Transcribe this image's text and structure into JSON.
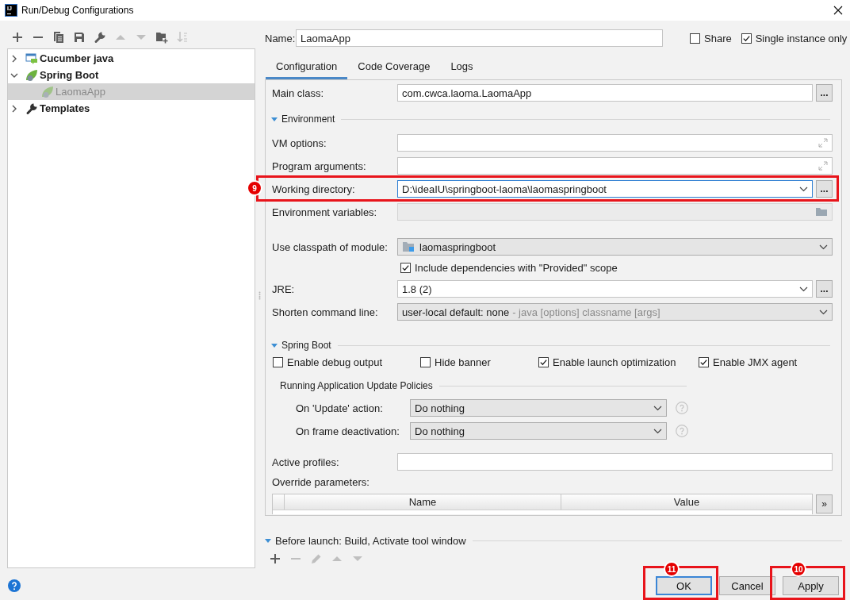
{
  "window": {
    "logo": "IJ",
    "title": "Run/Debug Configurations"
  },
  "sidebar": {
    "toolbar": [
      {
        "kind": "add",
        "disabled": false
      },
      {
        "kind": "remove",
        "disabled": false
      },
      {
        "kind": "copy",
        "disabled": false
      },
      {
        "kind": "save",
        "disabled": false
      },
      {
        "kind": "wrench",
        "disabled": false
      },
      {
        "kind": "up",
        "disabled": true
      },
      {
        "kind": "down",
        "disabled": true
      },
      {
        "kind": "folder",
        "disabled": false
      },
      {
        "kind": "sort",
        "disabled": true
      }
    ],
    "tree": [
      {
        "label": "Cucumber java",
        "kind": "cucumber",
        "expanded": false,
        "selected": false,
        "dimmed": false
      },
      {
        "label": "Spring Boot",
        "kind": "spring",
        "expanded": true,
        "selected": false,
        "dimmed": false,
        "children": [
          {
            "label": "LaomaApp",
            "kind": "spring",
            "selected": true,
            "dimmed": true
          }
        ]
      },
      {
        "label": "Templates",
        "kind": "templates",
        "expanded": false,
        "selected": false,
        "dimmed": false
      }
    ]
  },
  "config": {
    "name": {
      "label": "Name:",
      "value": "LaomaApp"
    },
    "options": [
      {
        "label": "Share",
        "checked": false
      },
      {
        "label": "Single instance only",
        "checked": true
      }
    ],
    "tabs": [
      {
        "label": "Configuration",
        "selected": true
      },
      {
        "label": "Code Coverage",
        "selected": false
      },
      {
        "label": "Logs",
        "selected": false
      }
    ],
    "sections": [
      {
        "rows": [
          {
            "kind": "field",
            "label": "Main class:",
            "value": "com.cwca.laoma.LaomaApp",
            "browse": "...",
            "disabled": false
          }
        ]
      },
      {
        "title": "Environment",
        "expanded": true,
        "rows": [
          {
            "kind": "expandable",
            "label": "VM options:",
            "disabled": false
          },
          {
            "kind": "expandable",
            "label": "Program arguments:",
            "disabled": false
          },
          {
            "kind": "combo",
            "label": "Working directory:",
            "value": "D:\\ideaIU\\springboot-laoma\\laomaspringboot",
            "browse": "...",
            "focused": true,
            "callout": "9"
          },
          {
            "kind": "folderfield",
            "label": "Environment variables:",
            "disabled": true
          },
          {
            "kind": "module",
            "label": "Use classpath of module:",
            "value": "laomaspringboot"
          },
          {
            "kind": "checkbox",
            "label": "Include dependencies with \"Provided\" scope",
            "checked": true
          },
          {
            "kind": "combo",
            "label": "JRE:",
            "value": "1.8 (2)",
            "browse": "...",
            "focused": false
          },
          {
            "kind": "select",
            "label": "Shorten command line:",
            "value": "user-local default: none",
            "hint": "- java [options] classname [args]"
          }
        ]
      },
      {
        "title": "Spring Boot",
        "expanded": true,
        "rows": [
          {
            "kind": "checkboxes",
            "items": [
              {
                "label": "Enable debug output",
                "checked": false
              },
              {
                "label": "Hide banner",
                "checked": false
              },
              {
                "label": "Enable launch optimization",
                "checked": true
              },
              {
                "label": "Enable JMX agent",
                "checked": true
              }
            ]
          },
          {
            "kind": "group",
            "title": "Running Application Update Policies",
            "rows": [
              {
                "kind": "select",
                "label": "On 'Update' action:",
                "value": "Do nothing",
                "help": true
              },
              {
                "kind": "select",
                "label": "On frame deactivation:",
                "value": "Do nothing",
                "help": true
              }
            ]
          },
          {
            "kind": "field",
            "label": "Active profiles:",
            "disabled": false
          },
          {
            "kind": "table",
            "label": "Override parameters:",
            "columns": [
              "Name",
              "Value"
            ],
            "more": "»"
          }
        ]
      }
    ]
  },
  "before_launch": {
    "title": "Before launch: Build, Activate tool window",
    "expanded": true,
    "toolbar": [
      {
        "kind": "add",
        "disabled": false
      },
      {
        "kind": "remove",
        "disabled": true
      },
      {
        "kind": "edit",
        "disabled": true
      },
      {
        "kind": "up",
        "disabled": true
      },
      {
        "kind": "down",
        "disabled": true
      }
    ]
  },
  "buttons": [
    {
      "label": "OK",
      "default": true,
      "callout": "11"
    },
    {
      "label": "Cancel",
      "default": false
    },
    {
      "label": "Apply",
      "default": false,
      "callout": "10"
    }
  ]
}
